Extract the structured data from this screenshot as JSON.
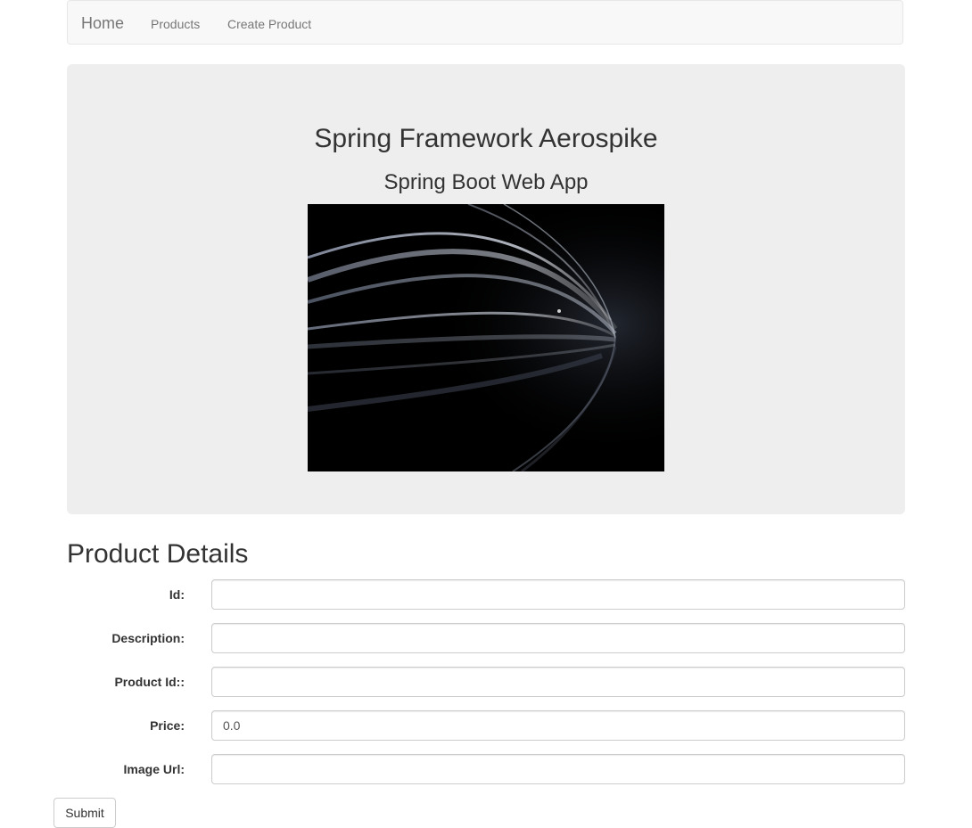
{
  "navbar": {
    "brand": "Home",
    "links": [
      "Products",
      "Create Product"
    ]
  },
  "jumbotron": {
    "title": "Spring Framework Aerospike",
    "subtitle": "Spring Boot Web App"
  },
  "form": {
    "title": "Product Details",
    "fields": [
      {
        "label": "Id:",
        "value": ""
      },
      {
        "label": "Description:",
        "value": ""
      },
      {
        "label": "Product Id::",
        "value": ""
      },
      {
        "label": "Price:",
        "value": "0.0"
      },
      {
        "label": "Image Url:",
        "value": ""
      }
    ],
    "submit_label": "Submit"
  }
}
